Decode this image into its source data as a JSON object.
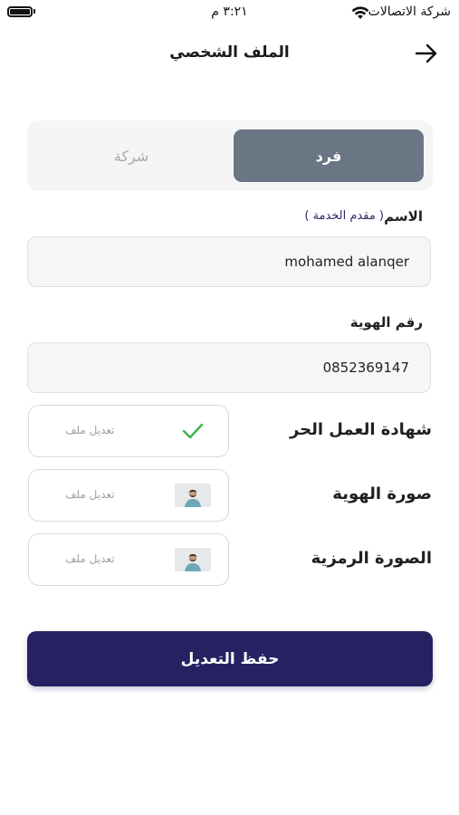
{
  "status_bar": {
    "carrier": "شركة الاتصالات",
    "time": "٣:٢١ م"
  },
  "header": {
    "title": "الملف الشخصي",
    "back_icon": "arrow-right-icon"
  },
  "account_type": {
    "options": [
      {
        "label": "فرد",
        "selected": true
      },
      {
        "label": "شركة",
        "selected": false
      }
    ]
  },
  "form": {
    "name": {
      "label": "الاسم",
      "hint": "( مقدم الخدمة )",
      "value": "mohamed alanqer"
    },
    "id_number": {
      "label": "رقم الهوية",
      "value": "0852369147"
    }
  },
  "files": [
    {
      "label": "شهادة العمل الحر",
      "edit_label": "تعديل ملف",
      "status": "uploaded-check"
    },
    {
      "label": "صورة الهوية",
      "edit_label": "تعديل ملف",
      "status": "image-thumbnail"
    },
    {
      "label": "الصورة الرمزية",
      "edit_label": "تعديل ملف",
      "status": "image-thumbnail"
    }
  ],
  "actions": {
    "save_label": "حفظ التعديل"
  },
  "colors": {
    "primary": "#262262",
    "segment_active": "#6a7684",
    "success_check": "#3bb54a",
    "field_bg": "#f6f6f7"
  }
}
